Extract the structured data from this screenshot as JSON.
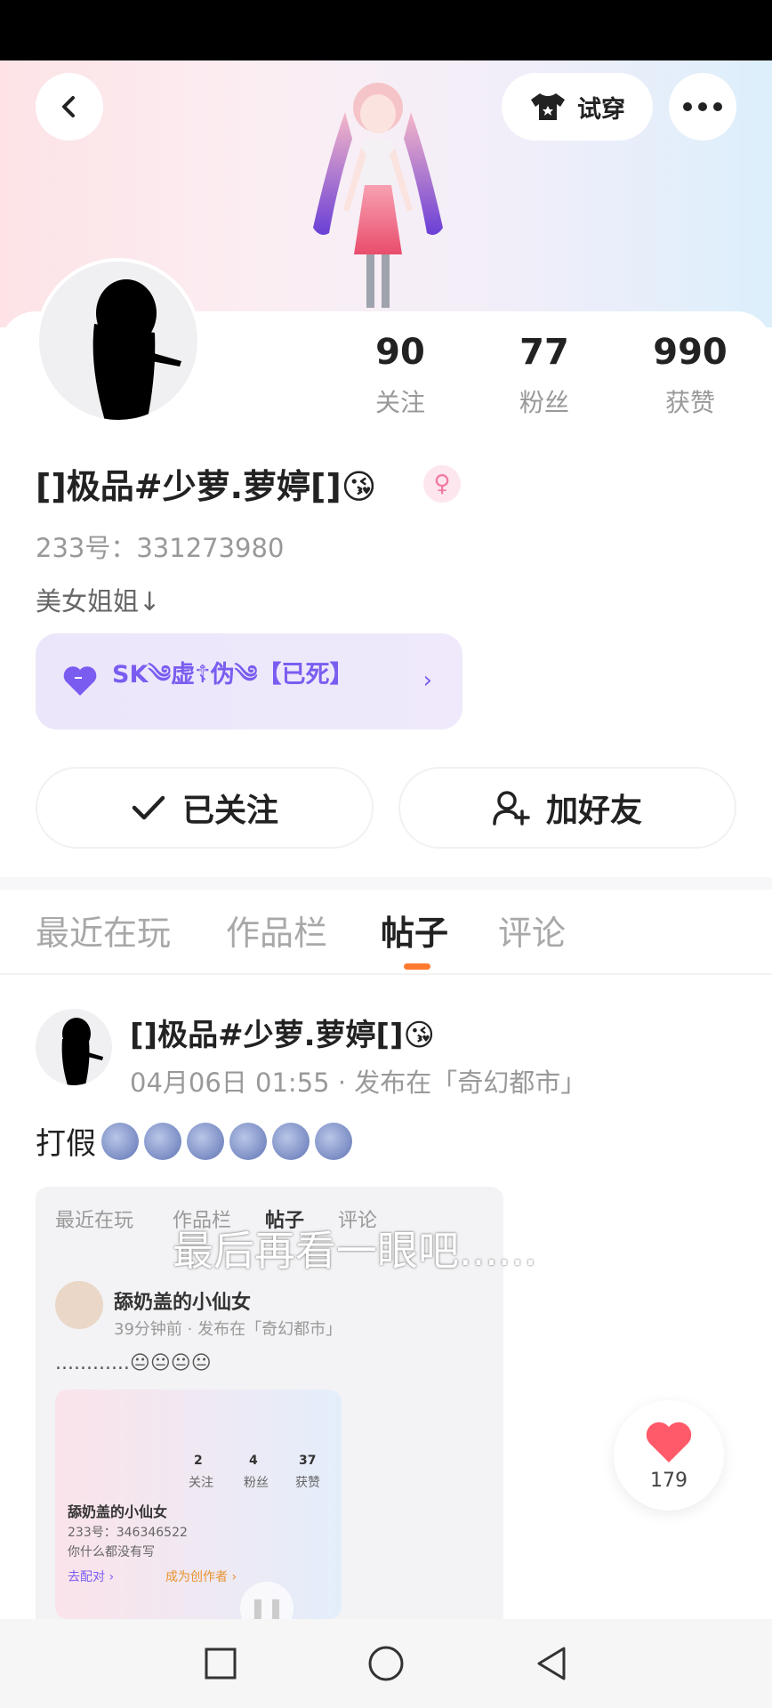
{
  "header": {
    "try_on_label": "试穿"
  },
  "profile": {
    "stats": [
      {
        "value": "90",
        "label": "关注"
      },
      {
        "value": "77",
        "label": "粉丝"
      },
      {
        "value": "990",
        "label": "获赞"
      }
    ],
    "nickname": "[]极品#少萝.萝婷[]😘",
    "gender_symbol": "♀",
    "uid": "233号：331273980",
    "bio": "美女姐姐↓",
    "club_name": "SK༄虚☦伪༄【已死】",
    "follow_label": "已关注",
    "add_friend_label": "加好友"
  },
  "tabs": [
    {
      "label": "最近在玩",
      "active": false
    },
    {
      "label": "作品栏",
      "active": false
    },
    {
      "label": "帖子",
      "active": true
    },
    {
      "label": "评论",
      "active": false
    }
  ],
  "post": {
    "author": "[]极品#少萝.萝婷[]😘",
    "meta": "04月06日 01:55 · 发布在「奇幻都市」",
    "text": "打假",
    "image": {
      "tabs": [
        "最近在玩",
        "作品栏",
        "帖子",
        "评论"
      ],
      "author": "舔奶盖的小仙女",
      "meta": "39分钟前 · 发布在「奇幻都市」",
      "text": "............😐😐😐😐",
      "stats": [
        {
          "value": "2",
          "label": "关注"
        },
        {
          "value": "4",
          "label": "粉丝"
        },
        {
          "value": "37",
          "label": "获赞"
        }
      ],
      "name": "舔奶盖的小仙女",
      "uid": "233号：346346522",
      "bio": "你什么都没有写",
      "btn1": "去配对 ›",
      "btn2": "成为创作者 ›"
    },
    "caption": "最后再看一眼吧......"
  },
  "like_count": "179",
  "colors": {
    "accent": "#ff7a2f",
    "club": "#7a5df0",
    "like": "#ff5a6a"
  }
}
